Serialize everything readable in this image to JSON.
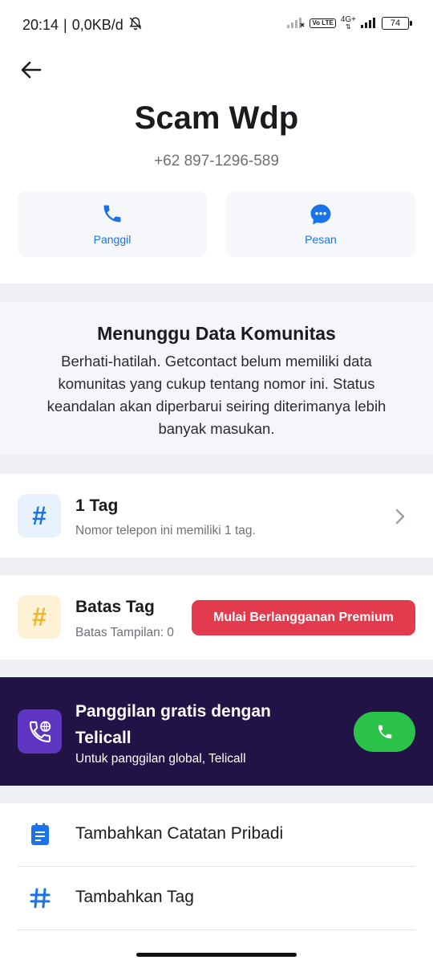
{
  "status_bar": {
    "time": "20:14",
    "separator": "|",
    "net_speed": "0,0KB/d",
    "volte": "Vo LTE",
    "network_type": "4G+",
    "battery": "74"
  },
  "contact": {
    "name": "Scam Wdp",
    "phone": "+62 897-1296-589"
  },
  "actions": {
    "call_label": "Panggil",
    "message_label": "Pesan"
  },
  "community": {
    "title": "Menunggu Data Komunitas",
    "body": "Berhati-hatilah. Getcontact belum memiliki data komunitas yang cukup tentang nomor ini. Status keandalan akan diperbarui seiring diterimanya lebih banyak masukan."
  },
  "tags": {
    "title": "1 Tag",
    "subtitle": "Nomor telepon ini memiliki 1 tag.",
    "symbol": "#"
  },
  "tag_limit": {
    "title": "Batas Tag",
    "subtitle": "Batas Tampilan: 0",
    "symbol": "#",
    "premium_button": "Mulai Berlangganan Premium"
  },
  "telicall": {
    "title": "Panggilan gratis dengan Telicall",
    "subtitle": "Untuk panggilan global, Telicall"
  },
  "list": {
    "add_note": "Tambahkan Catatan Pribadi",
    "add_tag": "Tambahkan Tag"
  },
  "colors": {
    "accent_blue": "#1a73e8",
    "premium_red": "#e23b4e",
    "telicall_bg": "#211346",
    "call_green": "#2bc24a"
  }
}
